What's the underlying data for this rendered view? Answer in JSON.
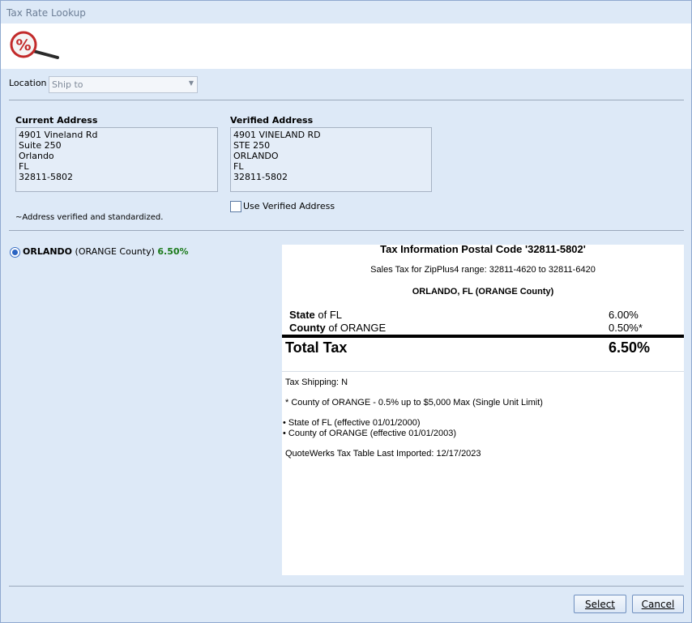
{
  "window": {
    "title": "Tax Rate Lookup"
  },
  "banner": {
    "icon": "percent-magnifier-icon"
  },
  "location": {
    "label": "Location",
    "value": "Ship to"
  },
  "current_address": {
    "heading": "Current Address",
    "lines": [
      "4901 Vineland Rd",
      "Suite 250",
      "Orlando",
      "FL",
      "32811-5802"
    ]
  },
  "verified_address": {
    "heading": "Verified Address",
    "lines": [
      "4901 VINELAND RD",
      "STE 250",
      "ORLANDO",
      "FL",
      "32811-5802"
    ]
  },
  "use_verified_label": "Use Verified Address",
  "verification_note": "~Address verified and standardized.",
  "result": {
    "city": "ORLANDO",
    "county": "(ORANGE County)",
    "rate": "6.50%"
  },
  "tax_info": {
    "title": "Tax Information Postal Code '32811-5802'",
    "range": "Sales Tax for ZipPlus4 range: 32811-4620 to 32811-6420",
    "location": "ORLANDO, FL (ORANGE County)",
    "rows": [
      {
        "bold": "State",
        "rest": " of FL",
        "rate": "6.00%"
      },
      {
        "bold": "County",
        "rest": " of ORANGE",
        "rate": "0.50%*"
      }
    ],
    "total_label": "Total Tax",
    "total_rate": "6.50%",
    "shipping": "Tax Shipping: N",
    "footnote": "* County of ORANGE - 0.5% up to $5,000 Max (Single Unit Limit)",
    "effective": [
      "• State of FL (effective 01/01/2000)",
      "• County of ORANGE (effective 01/01/2003)"
    ],
    "imported": "QuoteWerks Tax Table Last Imported: 12/17/2023"
  },
  "buttons": {
    "select": "Select",
    "cancel": "Cancel"
  }
}
